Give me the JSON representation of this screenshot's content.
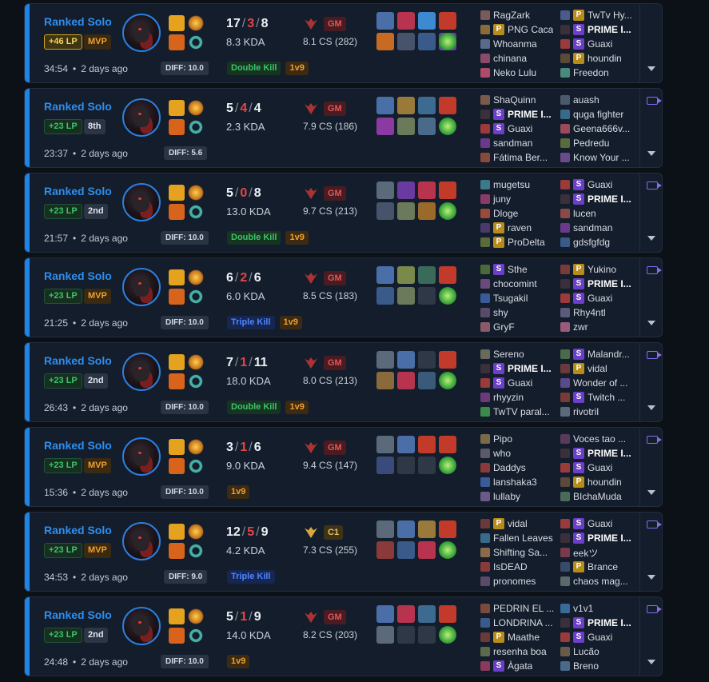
{
  "colors": {
    "accent": "#1e85e8",
    "death": "#e84545",
    "gm": "#e35555",
    "win_bg": "#141d2b",
    "double_kill": "#3dc26b",
    "triple_kill": "#4d86ff",
    "oneVnine": "#f0a030",
    "video": "#8a6cf0"
  },
  "icons": {
    "rank_gm": "grandmaster-crest-icon",
    "rank_c1": "challenger-crest-icon",
    "record": "video-camera-icon",
    "expand": "chevron-down-icon"
  },
  "matches": [
    {
      "queue": "Ranked Solo",
      "lp": "+46 LP",
      "lp_style": "gold",
      "placement": "MVP",
      "placement_style": "mvp",
      "duration": "34:54",
      "ago": "2 days ago",
      "diff": "DIFF: 10.0",
      "kills": "17",
      "deaths": "3",
      "assists": "8",
      "kda": "8.3 KDA",
      "tier": "GM",
      "tier_style": "gm",
      "cs": "8.1 CS (282)",
      "tags": [
        {
          "text": "Double Kill",
          "style": "dk"
        },
        {
          "text": "1v9",
          "style": "v9"
        }
      ],
      "has_video": false,
      "items": [
        "#4a6fa8",
        "#b8344e",
        "#3d8ad0",
        "#c23a2a",
        "#c96a22",
        "#46536b",
        "#3a5a8a",
        "#5f4aa0",
        "#2f6e9e",
        "trinket"
      ],
      "team1": [
        {
          "name": "RagZark",
          "badge": "",
          "c": "#7b5a5a"
        },
        {
          "name": "PNG Caca",
          "badge": "P",
          "c": "#8a6a3a"
        },
        {
          "name": "Whoanma",
          "badge": "",
          "c": "#5a6a8a"
        },
        {
          "name": "chinana",
          "badge": "",
          "c": "#8a4a6a"
        },
        {
          "name": "Neko Lulu",
          "badge": "",
          "c": "#b04a6a"
        }
      ],
      "team2": [
        {
          "name": "TwTv Hy...",
          "badge": "P",
          "c": "#4a5a8a"
        },
        {
          "name": "PRIME I...",
          "badge": "S",
          "c": "#3a2f3a",
          "bold": true
        },
        {
          "name": "Guaxi",
          "badge": "S",
          "c": "#9a3a3a"
        },
        {
          "name": "houndin",
          "badge": "P",
          "c": "#5a4a3a"
        },
        {
          "name": "Freedon",
          "badge": "",
          "c": "#4a8a7a"
        }
      ]
    },
    {
      "queue": "Ranked Solo",
      "lp": "+23 LP",
      "lp_style": "gain",
      "placement": "8th",
      "placement_style": "num",
      "duration": "23:37",
      "ago": "2 days ago",
      "diff": "DIFF: 5.6",
      "kills": "5",
      "deaths": "4",
      "assists": "4",
      "kda": "2.3 KDA",
      "tier": "GM",
      "tier_style": "gm",
      "cs": "7.9 CS (186)",
      "tags": [],
      "has_video": true,
      "items": [
        "#4a6fa8",
        "#9a7a3a",
        "#3d6a90",
        "#c23a2a",
        "#8a3aa0",
        "#6a7a5a",
        "#4a6a8a",
        "trinket"
      ],
      "team1": [
        {
          "name": "ShaQuinn",
          "badge": "",
          "c": "#7a5a4a"
        },
        {
          "name": "PRIME I...",
          "badge": "S",
          "c": "#3a2f3a",
          "bold": true
        },
        {
          "name": "Guaxi",
          "badge": "S",
          "c": "#9a3a3a"
        },
        {
          "name": "sandman",
          "badge": "",
          "c": "#6a3a8a"
        },
        {
          "name": "Fátima Ber...",
          "badge": "",
          "c": "#8a4a3a"
        }
      ],
      "team2": [
        {
          "name": "auash",
          "badge": "",
          "c": "#4a5a6a"
        },
        {
          "name": "quga fighter",
          "badge": "",
          "c": "#3a6a8a"
        },
        {
          "name": "Geena666v...",
          "badge": "",
          "c": "#9a4a5a"
        },
        {
          "name": "Pedredu",
          "badge": "",
          "c": "#5a6a3a"
        },
        {
          "name": "Know Your ...",
          "badge": "",
          "c": "#6a4a8a"
        }
      ]
    },
    {
      "queue": "Ranked Solo",
      "lp": "+23 LP",
      "lp_style": "gain",
      "placement": "2nd",
      "placement_style": "num",
      "duration": "21:57",
      "ago": "2 days ago",
      "diff": "DIFF: 10.0",
      "kills": "5",
      "deaths": "0",
      "assists": "8",
      "kda": "13.0 KDA",
      "tier": "GM",
      "tier_style": "gm",
      "cs": "9.7 CS (213)",
      "tags": [
        {
          "text": "Double Kill",
          "style": "dk"
        },
        {
          "text": "1v9",
          "style": "v9"
        }
      ],
      "has_video": true,
      "items": [
        "#5a6a7a",
        "#6a3aa0",
        "#b8344e",
        "#c23a2a",
        "#46536b",
        "#6a7a5a",
        "#9a6a2a",
        "trinket"
      ],
      "team1": [
        {
          "name": "mugetsu",
          "badge": "",
          "c": "#3a7a8a"
        },
        {
          "name": "juny",
          "badge": "",
          "c": "#8a3a6a"
        },
        {
          "name": "Dloge",
          "badge": "",
          "c": "#9a4a3a"
        },
        {
          "name": "raven",
          "badge": "P",
          "c": "#4a3a6a"
        },
        {
          "name": "ProDelta",
          "badge": "P",
          "c": "#5a6a3a"
        }
      ],
      "team2": [
        {
          "name": "Guaxi",
          "badge": "S",
          "c": "#9a3a3a"
        },
        {
          "name": "PRIME I...",
          "badge": "S",
          "c": "#3a2f3a",
          "bold": true
        },
        {
          "name": "lucen",
          "badge": "",
          "c": "#8a4a4a"
        },
        {
          "name": "sandman",
          "badge": "",
          "c": "#6a3a8a"
        },
        {
          "name": "gdsfgfdg",
          "badge": "",
          "c": "#3a5a8a"
        }
      ]
    },
    {
      "queue": "Ranked Solo",
      "lp": "+23 LP",
      "lp_style": "gain",
      "placement": "MVP",
      "placement_style": "mvp",
      "duration": "21:25",
      "ago": "2 days ago",
      "diff": "DIFF: 10.0",
      "kills": "6",
      "deaths": "2",
      "assists": "6",
      "kda": "6.0 KDA",
      "tier": "GM",
      "tier_style": "gm",
      "cs": "8.5 CS (183)",
      "tags": [
        {
          "text": "Triple Kill",
          "style": "tk"
        },
        {
          "text": "1v9",
          "style": "v9"
        }
      ],
      "has_video": true,
      "items": [
        "#4a6fa8",
        "#7a8a4a",
        "#3a6a5a",
        "#c23a2a",
        "#3a5a8a",
        "#6a7a5a",
        "empty",
        "trinket"
      ],
      "team1": [
        {
          "name": "Sthe",
          "badge": "S",
          "c": "#4a6a3a"
        },
        {
          "name": "chocomint",
          "badge": "",
          "c": "#6a4a7a"
        },
        {
          "name": "Tsugakil",
          "badge": "",
          "c": "#3a5a9a"
        },
        {
          "name": "shy",
          "badge": "",
          "c": "#5a4a6a"
        },
        {
          "name": "GryF",
          "badge": "",
          "c": "#8a5a6a"
        }
      ],
      "team2": [
        {
          "name": "Yukino",
          "badge": "P",
          "c": "#7a3a3a"
        },
        {
          "name": "PRIME I...",
          "badge": "S",
          "c": "#3a2f3a",
          "bold": true
        },
        {
          "name": "Guaxi",
          "badge": "S",
          "c": "#9a3a3a"
        },
        {
          "name": "Rhy4ntl",
          "badge": "",
          "c": "#5a5a7a"
        },
        {
          "name": "zwr",
          "badge": "",
          "c": "#9a5a7a"
        }
      ]
    },
    {
      "queue": "Ranked Solo",
      "lp": "+23 LP",
      "lp_style": "gain",
      "placement": "2nd",
      "placement_style": "num",
      "duration": "26:43",
      "ago": "2 days ago",
      "diff": "DIFF: 10.0",
      "kills": "7",
      "deaths": "1",
      "assists": "11",
      "kda": "18.0 KDA",
      "tier": "GM",
      "tier_style": "gm",
      "cs": "8.0 CS (213)",
      "tags": [
        {
          "text": "Double Kill",
          "style": "dk"
        },
        {
          "text": "1v9",
          "style": "v9"
        }
      ],
      "has_video": true,
      "items": [
        "#5a6a7a",
        "#4a6fa8",
        "empty",
        "#c23a2a",
        "#8a6a3a",
        "#b8344e",
        "#3a5a7a",
        "trinket"
      ],
      "team1": [
        {
          "name": "Sereno",
          "badge": "",
          "c": "#6a6a5a"
        },
        {
          "name": "PRIME I...",
          "badge": "S",
          "c": "#3a2f3a",
          "bold": true
        },
        {
          "name": "Guaxi",
          "badge": "S",
          "c": "#9a3a3a"
        },
        {
          "name": "rhyyzin",
          "badge": "",
          "c": "#6a3a7a"
        },
        {
          "name": "TwTV paral...",
          "badge": "",
          "c": "#3a8a4a"
        }
      ],
      "team2": [
        {
          "name": "Malandr...",
          "badge": "S",
          "c": "#4a6a4a"
        },
        {
          "name": "vidal",
          "badge": "P",
          "c": "#6a3a3a"
        },
        {
          "name": "Wonder of ...",
          "badge": "",
          "c": "#5a4a8a"
        },
        {
          "name": "Twitch ...",
          "badge": "S",
          "c": "#7a3a3a"
        },
        {
          "name": "rivotril",
          "badge": "",
          "c": "#5a6a7a"
        }
      ]
    },
    {
      "queue": "Ranked Solo",
      "lp": "+23 LP",
      "lp_style": "gain",
      "placement": "MVP",
      "placement_style": "mvp",
      "duration": "15:36",
      "ago": "2 days ago",
      "diff": "DIFF: 10.0",
      "kills": "3",
      "deaths": "1",
      "assists": "6",
      "kda": "9.0 KDA",
      "tier": "GM",
      "tier_style": "gm",
      "cs": "9.4 CS (147)",
      "tags": [
        {
          "text": "1v9",
          "style": "v9"
        }
      ],
      "has_video": true,
      "items": [
        "#5a6a7a",
        "#4a6fa8",
        "#c23a2a",
        "#c23a2a",
        "#3a4a7a",
        "empty",
        "empty",
        "trinket"
      ],
      "team1": [
        {
          "name": "Pipo",
          "badge": "",
          "c": "#7a6a4a"
        },
        {
          "name": "who",
          "badge": "",
          "c": "#5a5a6a"
        },
        {
          "name": "Daddys",
          "badge": "",
          "c": "#8a3a3a"
        },
        {
          "name": "lanshaka3",
          "badge": "",
          "c": "#3a5a9a"
        },
        {
          "name": "lullaby",
          "badge": "",
          "c": "#6a5a8a"
        }
      ],
      "team2": [
        {
          "name": "Voces tao ...",
          "badge": "",
          "c": "#5a3a5a"
        },
        {
          "name": "PRIME I...",
          "badge": "S",
          "c": "#3a2f3a",
          "bold": true
        },
        {
          "name": "Guaxi",
          "badge": "S",
          "c": "#9a3a3a"
        },
        {
          "name": "houndin",
          "badge": "P",
          "c": "#5a4a3a"
        },
        {
          "name": "BIchaMuda",
          "badge": "",
          "c": "#4a6a5a"
        }
      ]
    },
    {
      "queue": "Ranked Solo",
      "lp": "+23 LP",
      "lp_style": "gain",
      "placement": "MVP",
      "placement_style": "mvp",
      "duration": "34:53",
      "ago": "2 days ago",
      "diff": "DIFF: 9.0",
      "kills": "12",
      "deaths": "5",
      "assists": "9",
      "kda": "4.2 KDA",
      "tier": "C1",
      "tier_style": "c1",
      "cs": "7.3 CS (255)",
      "tags": [
        {
          "text": "Triple Kill",
          "style": "tk"
        }
      ],
      "has_video": true,
      "items": [
        "#5a6a7a",
        "#4a6fa8",
        "#9a7a3a",
        "#c23a2a",
        "#8a3a3a",
        "#3a5a8a",
        "#b8344e",
        "trinket"
      ],
      "team1": [
        {
          "name": "vidal",
          "badge": "P",
          "c": "#6a3a3a"
        },
        {
          "name": "Fallen Leaves",
          "badge": "",
          "c": "#3a6a8a"
        },
        {
          "name": "Shifting Sa...",
          "badge": "",
          "c": "#8a6a4a"
        },
        {
          "name": "IsDEAD",
          "badge": "",
          "c": "#8a3a3a"
        },
        {
          "name": "pronomes",
          "badge": "",
          "c": "#5a4a6a"
        }
      ],
      "team2": [
        {
          "name": "Guaxi",
          "badge": "S",
          "c": "#9a3a3a"
        },
        {
          "name": "PRIME I...",
          "badge": "S",
          "c": "#3a2f3a",
          "bold": true
        },
        {
          "name": "eekツ",
          "badge": "",
          "c": "#7a3a4a"
        },
        {
          "name": "Brance",
          "badge": "P",
          "c": "#3a4a6a"
        },
        {
          "name": "chaos mag...",
          "badge": "",
          "c": "#5a6a6a"
        }
      ]
    },
    {
      "queue": "Ranked Solo",
      "lp": "+23 LP",
      "lp_style": "gain",
      "placement": "2nd",
      "placement_style": "num",
      "duration": "24:48",
      "ago": "2 days ago",
      "diff": "DIFF: 10.0",
      "kills": "5",
      "deaths": "1",
      "assists": "9",
      "kda": "14.0 KDA",
      "tier": "GM",
      "tier_style": "gm",
      "cs": "8.2 CS (203)",
      "tags": [
        {
          "text": "1v9",
          "style": "v9"
        }
      ],
      "has_video": true,
      "items": [
        "#4a6fa8",
        "#b8344e",
        "#3d6a90",
        "#c23a2a",
        "#5a6a7a",
        "empty",
        "empty",
        "trinket"
      ],
      "team1": [
        {
          "name": "PEDRIN EL ...",
          "badge": "",
          "c": "#7a4a3a"
        },
        {
          "name": "LONDRINA ...",
          "badge": "",
          "c": "#3a5a8a"
        },
        {
          "name": "Maathe",
          "badge": "P",
          "c": "#6a3a3a"
        },
        {
          "name": "resenha boa",
          "badge": "",
          "c": "#5a6a4a"
        },
        {
          "name": "Àgata",
          "badge": "S",
          "c": "#8a3a5a"
        }
      ],
      "team2": [
        {
          "name": "v1v1",
          "badge": "",
          "c": "#3a6a9a"
        },
        {
          "name": "PRIME I...",
          "badge": "S",
          "c": "#3a2f3a",
          "bold": true
        },
        {
          "name": "Guaxi",
          "badge": "S",
          "c": "#9a3a3a"
        },
        {
          "name": "Lucão",
          "badge": "",
          "c": "#6a5a4a"
        },
        {
          "name": "Breno",
          "badge": "",
          "c": "#4a6a8a"
        }
      ]
    }
  ]
}
